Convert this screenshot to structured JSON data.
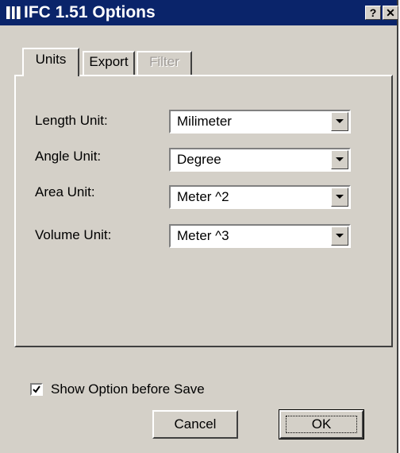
{
  "window": {
    "title": "IFC 1.51 Options",
    "help_label": "?",
    "close_label": "✕"
  },
  "tabs": [
    {
      "label": "Units",
      "active": true,
      "enabled": true
    },
    {
      "label": "Export",
      "active": false,
      "enabled": true
    },
    {
      "label": "Filter",
      "active": false,
      "enabled": false
    }
  ],
  "units": {
    "fields": [
      {
        "label": "Length Unit:",
        "value": "Milimeter"
      },
      {
        "label": "Angle Unit:",
        "value": "Degree"
      },
      {
        "label": "Area Unit:",
        "value": "Meter ^2"
      },
      {
        "label": "Volume Unit:",
        "value": "Meter ^3"
      }
    ]
  },
  "options": {
    "show_option_label": "Show Option before Save",
    "show_option_checked": true
  },
  "buttons": {
    "cancel_label": "Cancel",
    "ok_label": "OK"
  },
  "colors": {
    "titlebar": "#0a246a",
    "face": "#d4d0c8"
  }
}
